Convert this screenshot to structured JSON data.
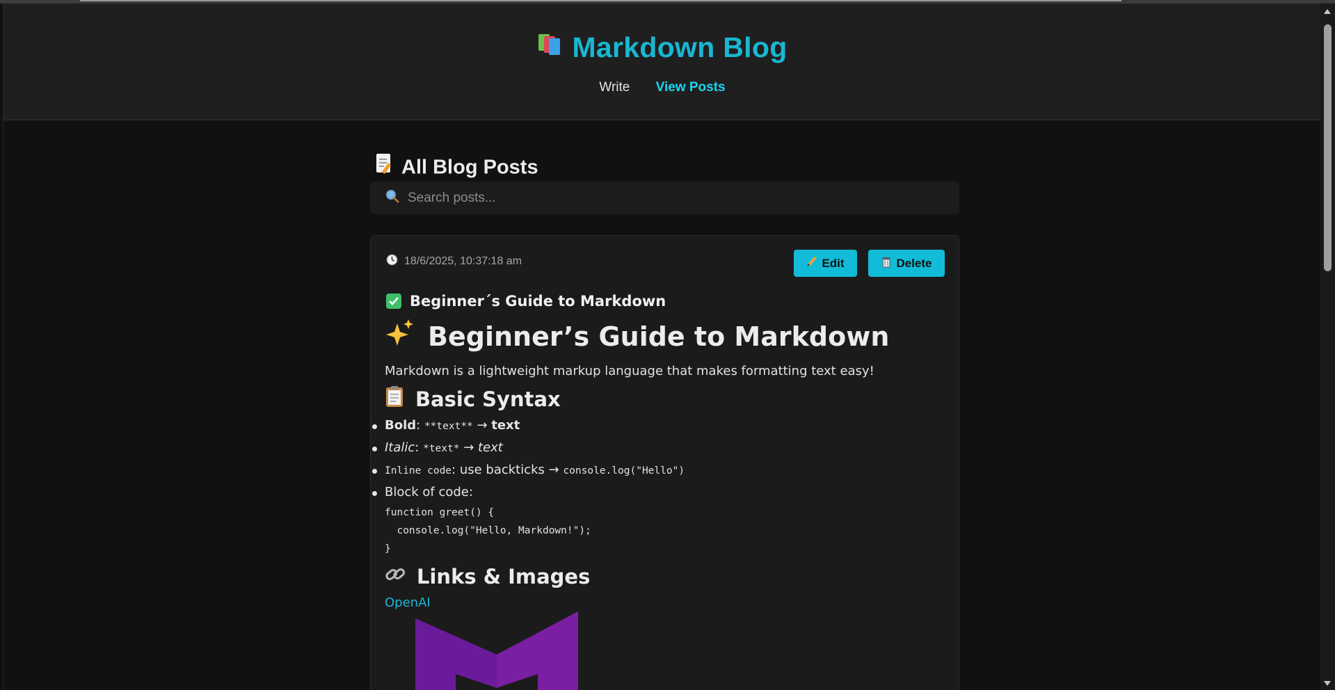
{
  "app": {
    "title": "Markdown Blog",
    "nav": [
      {
        "label": "Write",
        "active": false
      },
      {
        "label": "View Posts",
        "active": true
      }
    ]
  },
  "page": {
    "heading": "All Blog Posts",
    "search_placeholder": "Search posts..."
  },
  "post": {
    "timestamp": "18/6/2025, 10:37:18 am",
    "edit_label": "Edit",
    "delete_label": "Delete",
    "title": "Beginner´s Guide to Markdown",
    "h1": "Beginner’s Guide to Markdown",
    "intro": "Markdown is a lightweight markup language that makes formatting text easy!",
    "basic_syntax_heading": "Basic Syntax",
    "list": {
      "bold_label": "Bold",
      "bold_code": "**text**",
      "bold_result": "text",
      "italic_label": "Italic",
      "italic_code": "*text*",
      "italic_result": "text",
      "inline_label": "Inline code",
      "inline_text": ": use backticks → ",
      "inline_example": "console.log(\"Hello\")",
      "block_label": "Block of code:"
    },
    "code_block": "function greet() {\n  console.log(\"Hello, Markdown!\");\n}",
    "links_heading": "Links & Images",
    "link_text": "OpenAI"
  },
  "colors": {
    "accent": "#19b7d2",
    "accent_bright": "#18d6f2",
    "background": "#101010",
    "card": "#1b1b1b"
  }
}
